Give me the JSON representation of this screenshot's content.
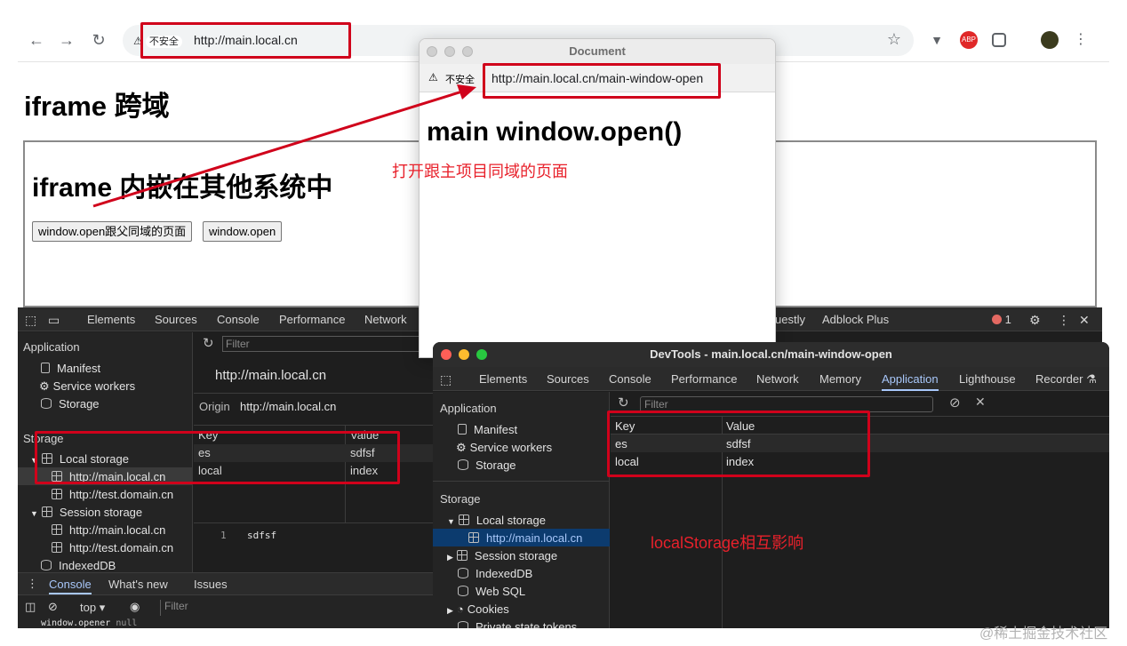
{
  "browser": {
    "back": "←",
    "forward": "→",
    "reload": "↻",
    "security_label": "不安全",
    "url": "http://main.local.cn",
    "abp_label": "ABP"
  },
  "page": {
    "title": "iframe 跨域",
    "iframe_title": "iframe 内嵌在其他系统中",
    "btn_open_same": "window.open跟父同域的页面",
    "btn_open": "window.open"
  },
  "popup": {
    "window_title": "Document",
    "security_label": "不安全",
    "url": "http://main.local.cn/main-window-open",
    "heading": "main window.open()"
  },
  "devtools_back": {
    "tabs": [
      "Elements",
      "Sources",
      "Console",
      "Performance",
      "Network",
      "uestly",
      "Adblock Plus"
    ],
    "error_count": "1",
    "filter_placeholder": "Filter",
    "sidebar": {
      "app_header": "Application",
      "app_items": [
        "Manifest",
        "Service workers",
        "Storage"
      ],
      "storage_header": "Storage",
      "local_storage": "Local storage",
      "local_children": [
        "http://main.local.cn",
        "http://test.domain.cn"
      ],
      "session_storage": "Session storage",
      "session_children": [
        "http://main.local.cn",
        "http://test.domain.cn"
      ],
      "indexeddb": "IndexedDB"
    },
    "origin_heading": "http://main.local.cn",
    "origin_label": "Origin",
    "origin_value": "http://main.local.cn",
    "table": {
      "headers": [
        "Key",
        "Value"
      ],
      "rows": [
        [
          "es",
          "sdfsf"
        ],
        [
          "local",
          "index"
        ]
      ]
    },
    "preview_line": "1",
    "preview_value": "sdfsf",
    "console_tabs": [
      "Console",
      "What's new",
      "Issues"
    ],
    "context": "top",
    "console_filter": "Filter",
    "console_line": "window.opener",
    "console_line_value": "null"
  },
  "devtools_front": {
    "window_title": "DevTools - main.local.cn/main-window-open",
    "tabs": [
      "Elements",
      "Sources",
      "Console",
      "Performance",
      "Network",
      "Memory",
      "Application",
      "Lighthouse",
      "Recorder"
    ],
    "filter_placeholder": "Filter",
    "sidebar": {
      "app_header": "Application",
      "app_items": [
        "Manifest",
        "Service workers",
        "Storage"
      ],
      "storage_header": "Storage",
      "local_storage": "Local storage",
      "local_child": "http://main.local.cn",
      "items": [
        "Session storage",
        "IndexedDB",
        "Web SQL",
        "Cookies",
        "Private state tokens"
      ]
    },
    "table": {
      "headers": [
        "Key",
        "Value"
      ],
      "rows": [
        [
          "es",
          "sdfsf"
        ],
        [
          "local",
          "index"
        ]
      ]
    }
  },
  "annotations": {
    "open_same_domain": "打开跟主项目同域的页面",
    "local_storage_shared": "localStorage相互影响",
    "color": "#d0021b"
  },
  "watermark": "@稀土掘金技术社区"
}
